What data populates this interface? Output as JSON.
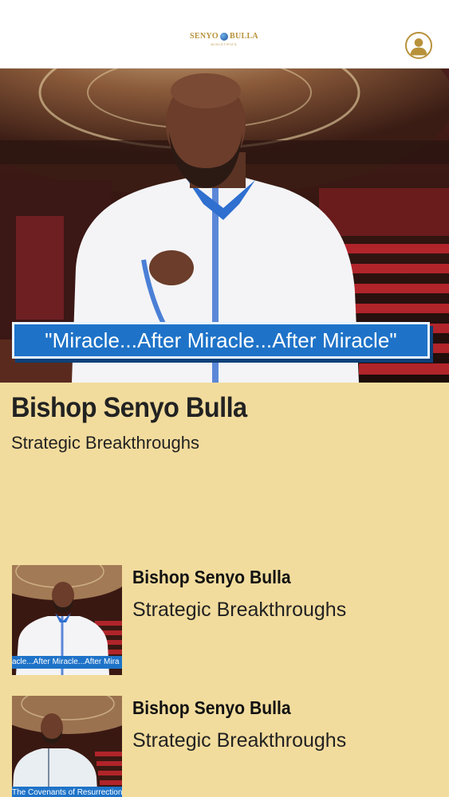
{
  "header": {
    "logo_word_left": "SENYO",
    "logo_word_right": "BULLA",
    "logo_tagline": "MINISTRIES",
    "profile_icon": "user-avatar-icon",
    "accent_color": "#b8923a"
  },
  "featured": {
    "banner_text": "\"Miracle...After Miracle...After Miracle\"",
    "title": "Bishop Senyo Bulla",
    "subtitle": "Strategic Breakthroughs"
  },
  "list": [
    {
      "thumb_caption": "acle...After Miracle...After Mira",
      "title": "Bishop Senyo Bulla",
      "subtitle": "Strategic Breakthroughs"
    },
    {
      "thumb_caption": "The Covenants of Resurrection",
      "title": "Bishop Senyo Bulla",
      "subtitle": "Strategic Breakthroughs"
    }
  ],
  "colors": {
    "background": "#f2dc9d",
    "banner_blue": "#1e73c8"
  }
}
